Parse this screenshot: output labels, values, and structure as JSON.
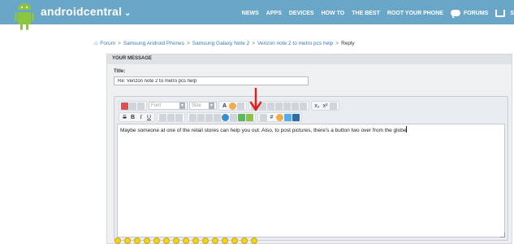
{
  "header": {
    "brand": "androidcentral",
    "nav": [
      "NEWS",
      "APPS",
      "DEVICES",
      "HOW TO",
      "THE BEST",
      "ROOT YOUR PHONE"
    ],
    "forums": "FORUMS",
    "cart_label": "S"
  },
  "breadcrumb": {
    "items": [
      "Forum",
      "Samsung Android Phones",
      "Samsung Galaxy Note 2",
      "Verizon note 2 to metro pcs help"
    ],
    "separator": ">",
    "current": "Reply"
  },
  "panel": {
    "heading": "YOUR MESSAGE",
    "title_label": "Title:",
    "title_value": "Re: Verizon note 2 to metro pcs help"
  },
  "editor": {
    "font_placeholder": "Font",
    "size_placeholder": "Size",
    "text_color_label": "A",
    "subscript": "x₂",
    "superscript": "x²",
    "format_buttons": [
      "S",
      "B",
      "I",
      "U"
    ],
    "hash": "#",
    "message": "Maybe someone at one of the retail stores can help you out. Also, to post pictures, there's a button two over from the globe"
  },
  "colors": {
    "topbar": "#6aa6c8",
    "link": "#3a7bbf",
    "annotation_arrow": "#e02020"
  },
  "smilies_count": 15
}
